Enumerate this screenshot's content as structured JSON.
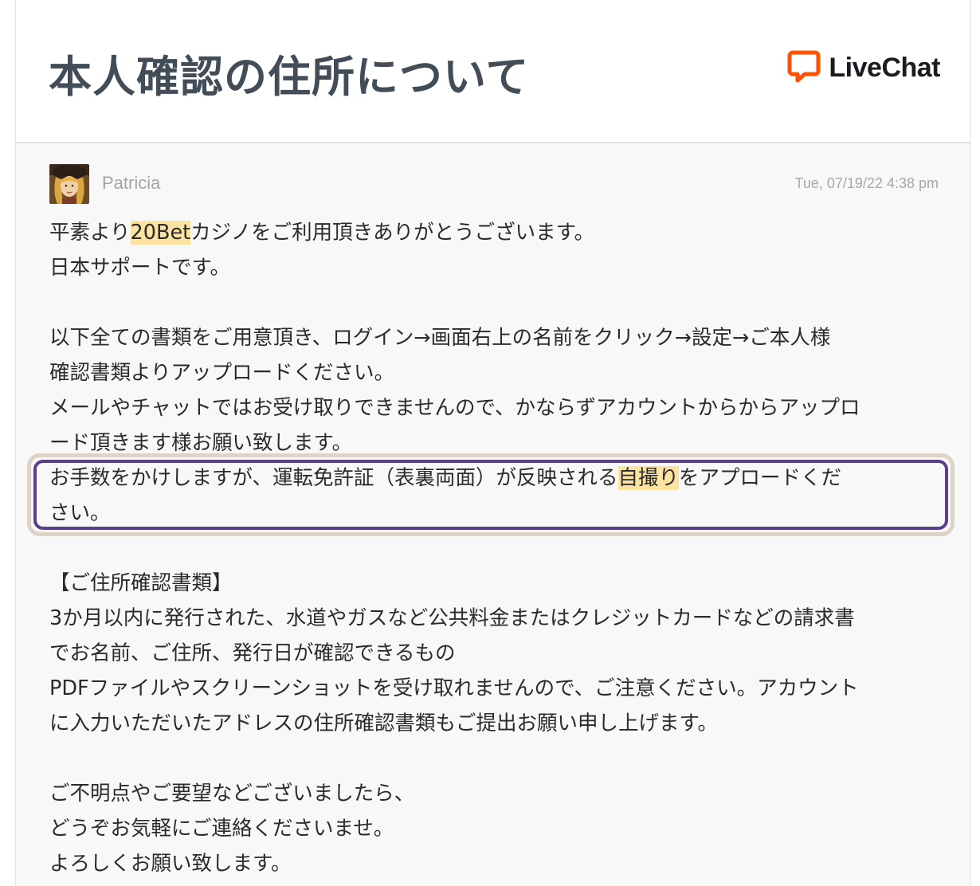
{
  "header": {
    "title": "本人確認の住所について",
    "brand": "LiveChat",
    "brand_icon": "livechat-logo-icon",
    "brand_color": "#ff5100"
  },
  "message": {
    "agent_name": "Patricia",
    "timestamp": "Tue, 07/19/22 4:38 pm",
    "highlight_color": "#fde3a1",
    "callout_color": "#5b3f8c",
    "lines": [
      {
        "pre": "平素より",
        "hl": "20Bet",
        "post": "カジノをご利用頂きありがとうございます。"
      },
      {
        "text": "日本サポートです。"
      },
      {
        "text": ""
      },
      {
        "text": "以下全ての書類をご用意頂き、ログイン→画面右上の名前をクリック→設定→ご本人様"
      },
      {
        "text": "確認書類よりアップロードください。"
      },
      {
        "text": "メールやチャットではお受け取りできませんので、かならずアカウントからからアップロ"
      },
      {
        "text": "ード頂きます様お願い致します。"
      },
      {
        "pre": "お手数をかけしますが、運転免許証（表裏両面）が反映される",
        "hl": "自撮り",
        "post": "をアプロードくだ"
      },
      {
        "text": "さい。"
      },
      {
        "text": ""
      },
      {
        "text": "【ご住所確認書類】"
      },
      {
        "text": "3か月以内に発行された、水道やガスなど公共料金またはクレジットカードなどの請求書"
      },
      {
        "text": "でお名前、ご住所、発行日が確認できるもの"
      },
      {
        "text": "PDFファイルやスクリーンショットを受け取れませんので、ご注意ください。アカウント"
      },
      {
        "text": "に入力いただいたアドレスの住所確認書類もご提出お願い申し上げます。"
      },
      {
        "text": ""
      },
      {
        "text": "ご不明点やご要望などございましたら、"
      },
      {
        "text": "どうぞお気軽にご連絡くださいませ。"
      },
      {
        "text": "よろしくお願い致します。"
      }
    ]
  }
}
